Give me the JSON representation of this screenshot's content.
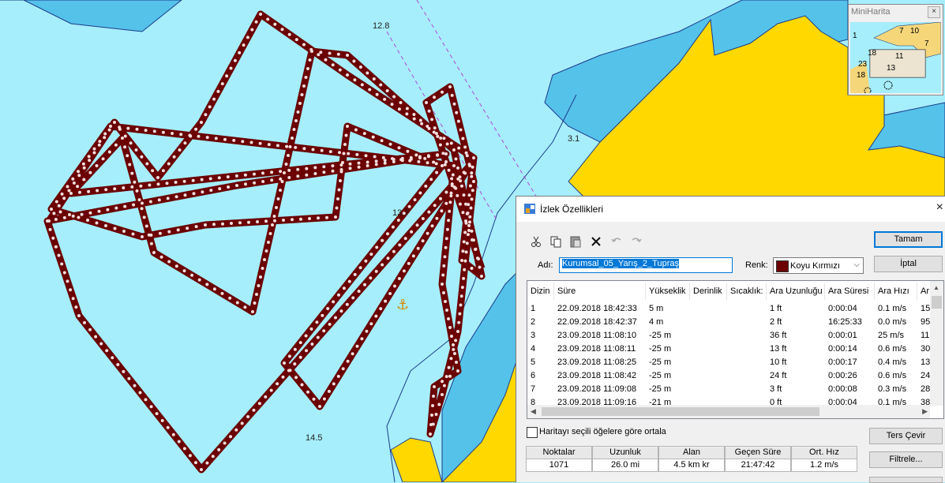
{
  "map": {
    "depths": [
      "12.8",
      "3.1",
      "13.7",
      "14.5"
    ],
    "colors": {
      "water": "#a6eefc",
      "shallow": "#55c2ea",
      "land": "#ffd800",
      "track": "#6b0000"
    }
  },
  "minimap": {
    "title": "MiniHarita",
    "close": "×",
    "labels": [
      "1",
      "7",
      "10",
      "7",
      "18",
      "11",
      "23",
      "13",
      "18"
    ]
  },
  "dialog": {
    "title": "İzlek Özellikleri",
    "close": "×",
    "toolbar": [
      "cut-icon",
      "copy-icon",
      "paste-icon",
      "delete-icon",
      "undo-icon",
      "redo-icon"
    ],
    "name_label": "Adı:",
    "name_value": "Kurumsal_05_Yarış_2_Tupraş",
    "color_label": "Renk:",
    "color_value": "Koyu Kırmızı",
    "color_hex": "#6b0000",
    "ok_button": "Tamam",
    "cancel_button": "İptal",
    "reverse_button": "Ters Çevir",
    "filter_button": "Filtrele...",
    "center_checkbox": "Haritayı seçili öğelere göre ortala",
    "columns": [
      "Dizin",
      "Süre",
      "Yükseklik",
      "Derinlik",
      "Sıcaklık:",
      "Ara Uzunluğu",
      "Ara Süresi",
      "Ara Hızı",
      "Ar"
    ],
    "rows": [
      [
        "1",
        "22.09.2018 18:42:33",
        "5 m",
        "",
        "",
        "1 ft",
        "0:00:04",
        "0.1 m/s",
        "15"
      ],
      [
        "2",
        "22.09.2018 18:42:37",
        "4 m",
        "",
        "",
        "2 ft",
        "16:25:33",
        "0.0 m/s",
        "95"
      ],
      [
        "3",
        "23.09.2018 11:08:10",
        "-25 m",
        "",
        "",
        "36 ft",
        "0:00:01",
        "25 m/s",
        "11"
      ],
      [
        "4",
        "23.09.2018 11:08:11",
        "-25 m",
        "",
        "",
        "13 ft",
        "0:00:14",
        "0.6 m/s",
        "30"
      ],
      [
        "5",
        "23.09.2018 11:08:25",
        "-25 m",
        "",
        "",
        "10 ft",
        "0:00:17",
        "0.4 m/s",
        "13"
      ],
      [
        "6",
        "23.09.2018 11:08:42",
        "-25 m",
        "",
        "",
        "24 ft",
        "0:00:26",
        "0.6 m/s",
        "24"
      ],
      [
        "7",
        "23.09.2018 11:09:08",
        "-25 m",
        "",
        "",
        "3 ft",
        "0:00:08",
        "0.3 m/s",
        "28"
      ],
      [
        "8",
        "23.09.2018 11:09:16",
        "-21 m",
        "",
        "",
        "0 ft",
        "0:00:04",
        "0.1 m/s",
        "38"
      ]
    ],
    "stats": [
      {
        "label": "Noktalar",
        "value": "1071"
      },
      {
        "label": "Uzunluk",
        "value": "26.0 mi"
      },
      {
        "label": "Alan",
        "value": "4.5 km kr"
      },
      {
        "label": "Geçen Süre",
        "value": "21:47:42"
      },
      {
        "label": "Ort. Hız",
        "value": "1.2 m/s"
      }
    ]
  }
}
